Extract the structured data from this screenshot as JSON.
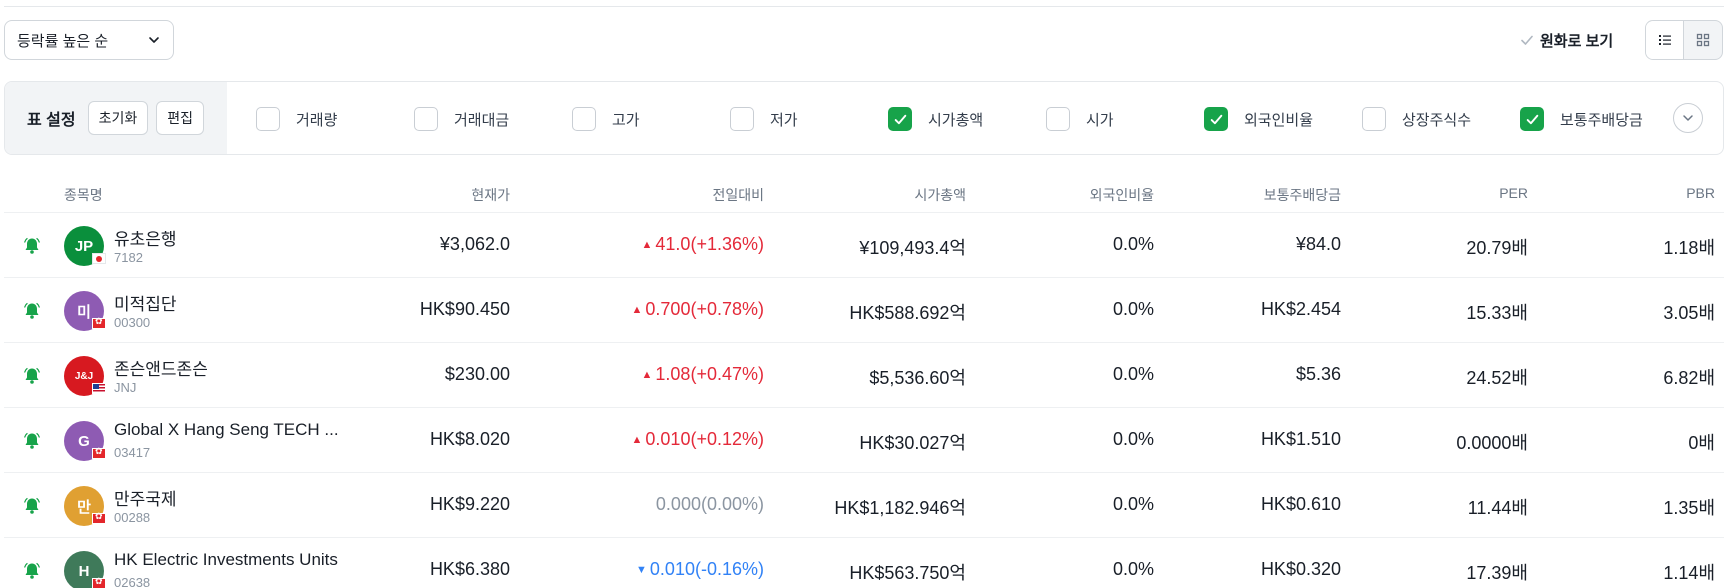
{
  "toolbar": {
    "sort_label": "등락률 높은 순",
    "krw_label": "원화로 보기"
  },
  "settings": {
    "title": "표 설정",
    "reset_label": "초기화",
    "edit_label": "편집",
    "columns": [
      {
        "label": "거래량",
        "checked": false
      },
      {
        "label": "거래대금",
        "checked": false
      },
      {
        "label": "고가",
        "checked": false
      },
      {
        "label": "저가",
        "checked": false
      },
      {
        "label": "시가총액",
        "checked": true
      },
      {
        "label": "시가",
        "checked": false
      },
      {
        "label": "외국인비율",
        "checked": true
      },
      {
        "label": "상장주식수",
        "checked": false
      },
      {
        "label": "보통주배당금",
        "checked": true
      }
    ]
  },
  "table": {
    "headers": {
      "name": "종목명",
      "price": "현재가",
      "change": "전일대비",
      "market_cap": "시가총액",
      "foreign_ratio": "외국인비율",
      "dividend": "보통주배당금",
      "per": "PER",
      "pbr": "PBR"
    },
    "rows": [
      {
        "name": "유초은행",
        "code": "7182",
        "logo_text": "JP",
        "logo_color": "#0a8f3c",
        "flag": "jp",
        "price": "¥3,062.0",
        "dir": "up",
        "change": "41.0",
        "change_pct": "(+1.36%)",
        "market_cap": "¥109,493.4억",
        "foreign_ratio": "0.0%",
        "dividend": "¥84.0",
        "per": "20.79배",
        "pbr": "1.18배"
      },
      {
        "name": "미적집단",
        "code": "00300",
        "logo_text": "미",
        "logo_color": "#8e5bb3",
        "flag": "hk",
        "price": "HK$90.450",
        "dir": "up",
        "change": "0.700",
        "change_pct": "(+0.78%)",
        "market_cap": "HK$588.692억",
        "foreign_ratio": "0.0%",
        "dividend": "HK$2.454",
        "per": "15.33배",
        "pbr": "3.05배"
      },
      {
        "name": "존슨앤드존슨",
        "code": "JNJ",
        "logo_text": "J&J",
        "logo_color": "#d71920",
        "flag": "us",
        "price": "$230.00",
        "dir": "up",
        "change": "1.08",
        "change_pct": "(+0.47%)",
        "market_cap": "$5,536.60억",
        "foreign_ratio": "0.0%",
        "dividend": "$5.36",
        "per": "24.52배",
        "pbr": "6.82배"
      },
      {
        "name": "Global X Hang Seng TECH ...",
        "code": "03417",
        "logo_text": "G",
        "logo_color": "#8e5bb3",
        "flag": "hk",
        "price": "HK$8.020",
        "dir": "up",
        "change": "0.010",
        "change_pct": "(+0.12%)",
        "market_cap": "HK$30.027억",
        "foreign_ratio": "0.0%",
        "dividend": "HK$1.510",
        "per": "0.0000배",
        "pbr": "0배"
      },
      {
        "name": "만주국제",
        "code": "00288",
        "logo_text": "만",
        "logo_color": "#e0a032",
        "flag": "hk",
        "price": "HK$9.220",
        "dir": "flat",
        "change": "0.000",
        "change_pct": "(0.00%)",
        "market_cap": "HK$1,182.946억",
        "foreign_ratio": "0.0%",
        "dividend": "HK$0.610",
        "per": "11.44배",
        "pbr": "1.35배"
      },
      {
        "name": "HK Electric Investments Units",
        "code": "02638",
        "logo_text": "H",
        "logo_color": "#3f7a5a",
        "flag": "hk",
        "price": "HK$6.380",
        "dir": "down",
        "change": "0.010",
        "change_pct": "(-0.16%)",
        "market_cap": "HK$563.750억",
        "foreign_ratio": "0.0%",
        "dividend": "HK$0.320",
        "per": "17.39배",
        "pbr": "1.14배"
      }
    ]
  },
  "colors": {
    "up": "#e42939",
    "down": "#3182f6",
    "flat": "#8b95a1",
    "check_green": "#17a34a",
    "bell_green": "#17a34a"
  }
}
